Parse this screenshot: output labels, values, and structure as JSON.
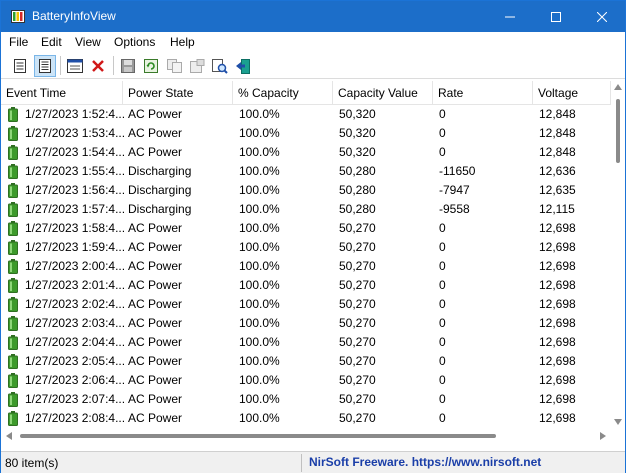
{
  "window": {
    "title": "BatteryInfoView"
  },
  "menu": [
    "File",
    "Edit",
    "View",
    "Options",
    "Help"
  ],
  "toolbar": {
    "buttons": [
      {
        "name": "battery-info-mode-icon"
      },
      {
        "name": "battery-log-mode-icon"
      },
      {
        "name": "properties-icon"
      },
      {
        "name": "delete-icon"
      },
      {
        "name": "save-icon"
      },
      {
        "name": "refresh-icon"
      },
      {
        "name": "copy-icon"
      },
      {
        "name": "html-report-icon"
      },
      {
        "name": "find-icon"
      },
      {
        "name": "exit-icon"
      }
    ]
  },
  "columns": [
    "Event Time",
    "Power State",
    "% Capacity",
    "Capacity Value",
    "Rate",
    "Voltage"
  ],
  "rows": [
    [
      "1/27/2023 1:52:4...",
      "AC Power",
      "100.0%",
      "50,320",
      "0",
      "12,848"
    ],
    [
      "1/27/2023 1:53:4...",
      "AC Power",
      "100.0%",
      "50,320",
      "0",
      "12,848"
    ],
    [
      "1/27/2023 1:54:4...",
      "AC Power",
      "100.0%",
      "50,320",
      "0",
      "12,848"
    ],
    [
      "1/27/2023 1:55:4...",
      "Discharging",
      "100.0%",
      "50,280",
      "-11650",
      "12,636"
    ],
    [
      "1/27/2023 1:56:4...",
      "Discharging",
      "100.0%",
      "50,280",
      "-7947",
      "12,635"
    ],
    [
      "1/27/2023 1:57:4...",
      "Discharging",
      "100.0%",
      "50,280",
      "-9558",
      "12,115"
    ],
    [
      "1/27/2023 1:58:4...",
      "AC Power",
      "100.0%",
      "50,270",
      "0",
      "12,698"
    ],
    [
      "1/27/2023 1:59:4...",
      "AC Power",
      "100.0%",
      "50,270",
      "0",
      "12,698"
    ],
    [
      "1/27/2023 2:00:4...",
      "AC Power",
      "100.0%",
      "50,270",
      "0",
      "12,698"
    ],
    [
      "1/27/2023 2:01:4...",
      "AC Power",
      "100.0%",
      "50,270",
      "0",
      "12,698"
    ],
    [
      "1/27/2023 2:02:4...",
      "AC Power",
      "100.0%",
      "50,270",
      "0",
      "12,698"
    ],
    [
      "1/27/2023 2:03:4...",
      "AC Power",
      "100.0%",
      "50,270",
      "0",
      "12,698"
    ],
    [
      "1/27/2023 2:04:4...",
      "AC Power",
      "100.0%",
      "50,270",
      "0",
      "12,698"
    ],
    [
      "1/27/2023 2:05:4...",
      "AC Power",
      "100.0%",
      "50,270",
      "0",
      "12,698"
    ],
    [
      "1/27/2023 2:06:4...",
      "AC Power",
      "100.0%",
      "50,270",
      "0",
      "12,698"
    ],
    [
      "1/27/2023 2:07:4...",
      "AC Power",
      "100.0%",
      "50,270",
      "0",
      "12,698"
    ],
    [
      "1/27/2023 2:08:4...",
      "AC Power",
      "100.0%",
      "50,270",
      "0",
      "12,698"
    ]
  ],
  "status": {
    "count": "80 item(s)",
    "link": "NirSoft Freeware. https://www.nirsoft.net"
  },
  "colors": {
    "titlebar": "#1c6ec9",
    "battery_icon": "#3d9a2b",
    "link": "#1a3ea8"
  }
}
